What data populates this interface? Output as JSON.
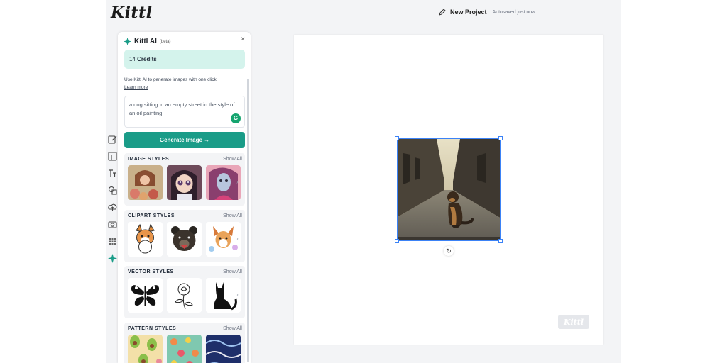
{
  "app": {
    "logo_text": "Kittl"
  },
  "header": {
    "project_name": "New Project",
    "autosave_status": "Autosaved just now",
    "icon": "pencil-icon"
  },
  "rail": {
    "icons": [
      "edit-icon",
      "layout-icon",
      "text-icon",
      "shapes-icon",
      "upload-icon",
      "camera-icon",
      "grid-icon",
      "ai-sparkle-icon"
    ]
  },
  "ai_panel": {
    "title": "Kittl AI",
    "badge": "(beta)",
    "credits_count": "14",
    "credits_label": "Credits",
    "description": "Use Kittl AI to generate images with one click.",
    "learn_more": "Learn more",
    "prompt_value": "a dog sitting in an empty street in the style of an oil painting",
    "generate_button": "Generate Image →",
    "sections": [
      {
        "title": "IMAGE STYLES",
        "show_all": "Show All"
      },
      {
        "title": "CLIPART STYLES",
        "show_all": "Show All"
      },
      {
        "title": "VECTOR STYLES",
        "show_all": "Show All"
      },
      {
        "title": "PATTERN STYLES",
        "show_all": "Show All"
      }
    ]
  },
  "canvas": {
    "watermark": "Kittl",
    "rotate_icon": "↻"
  },
  "colors": {
    "accent": "#1a9c88",
    "credits_bg": "#d4f3ec",
    "selection": "#3b82f6",
    "app_bg": "#f3f4f6"
  }
}
